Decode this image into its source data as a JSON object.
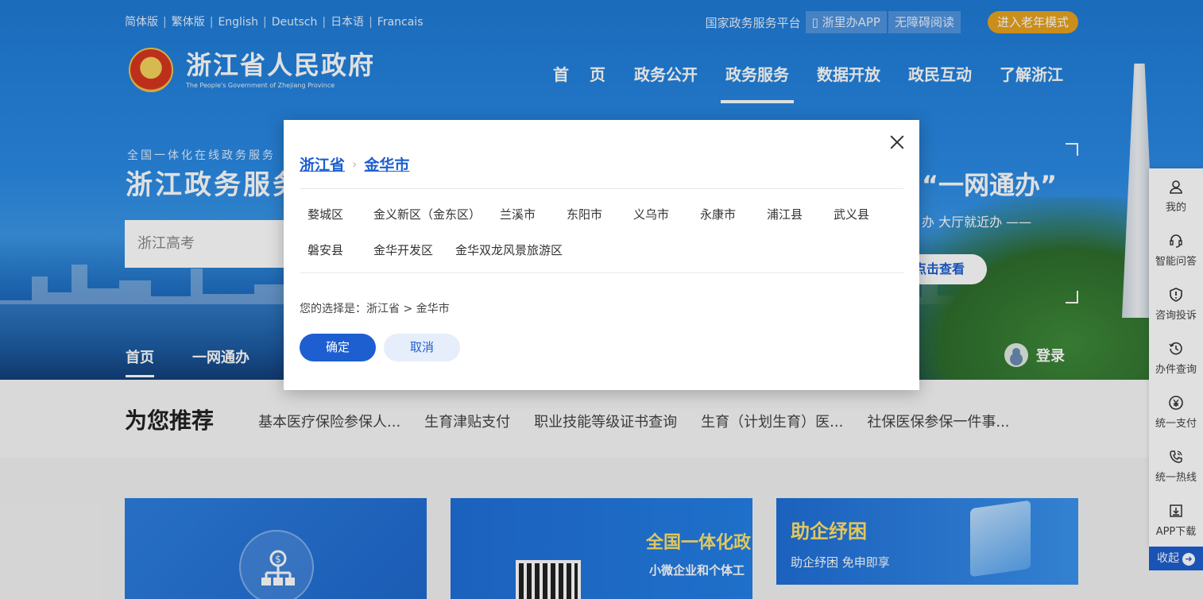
{
  "topbar": {
    "languages": [
      "简体版",
      "繁体版",
      "English",
      "Deutsch",
      "日本语",
      "Francais"
    ],
    "platform": "国家政务服务平台",
    "app_label": "浙里办APP",
    "accessibility_label": "无障碍阅读",
    "elder_mode_label": "进入老年模式"
  },
  "logo": {
    "title": "浙江省人民政府",
    "subtitle": "The People's Government of Zhejiang Province"
  },
  "main_nav": [
    "首页",
    "政务公开",
    "政务服务",
    "数据开放",
    "政民互动",
    "了解浙江"
  ],
  "main_nav_active": "政务服务",
  "hero": {
    "subtitle": "全国一体化在线政务服务",
    "title": "浙江政务服务",
    "slogan": "“一网通办”",
    "slogan_sub": "办 大厅就近办 ——",
    "view_button": "点击查看",
    "search_placeholder": "浙江高考"
  },
  "sub_nav": [
    "首页",
    "一网通办"
  ],
  "login_label": "登录",
  "recommend": {
    "title": "为您推荐",
    "links": [
      "基本医疗保险参保人...",
      "生育津贴支付",
      "职业技能等级证书查询",
      "生育（计划生育）医...",
      "社保医保参保一件事..."
    ]
  },
  "cards": {
    "card2_title": "全国一体化政",
    "card2_sub": "小微企业和个体工",
    "card3_title": "助企纾困",
    "card3_sub": "助企纾困 免申即享"
  },
  "sidebar": [
    {
      "label": "我的",
      "icon": "user-icon"
    },
    {
      "label": "智能问答",
      "icon": "headset-icon"
    },
    {
      "label": "咨询投诉",
      "icon": "alert-icon"
    },
    {
      "label": "办件查询",
      "icon": "history-icon"
    },
    {
      "label": "统一支付",
      "icon": "yen-icon"
    },
    {
      "label": "统一热线",
      "icon": "phone-icon"
    },
    {
      "label": "APP下载",
      "icon": "download-icon"
    }
  ],
  "collapse_label": "收起",
  "modal": {
    "breadcrumb": [
      "浙江省",
      "金华市"
    ],
    "areas": [
      "婺城区",
      "金义新区（金东区）",
      "兰溪市",
      "东阳市",
      "义乌市",
      "永康市",
      "浦江县",
      "武义县",
      "磐安县",
      "金华开发区",
      "金华双龙风景旅游区"
    ],
    "choice_text": "您的选择是：浙江省 > 金华市",
    "ok_label": "确定",
    "cancel_label": "取消"
  }
}
